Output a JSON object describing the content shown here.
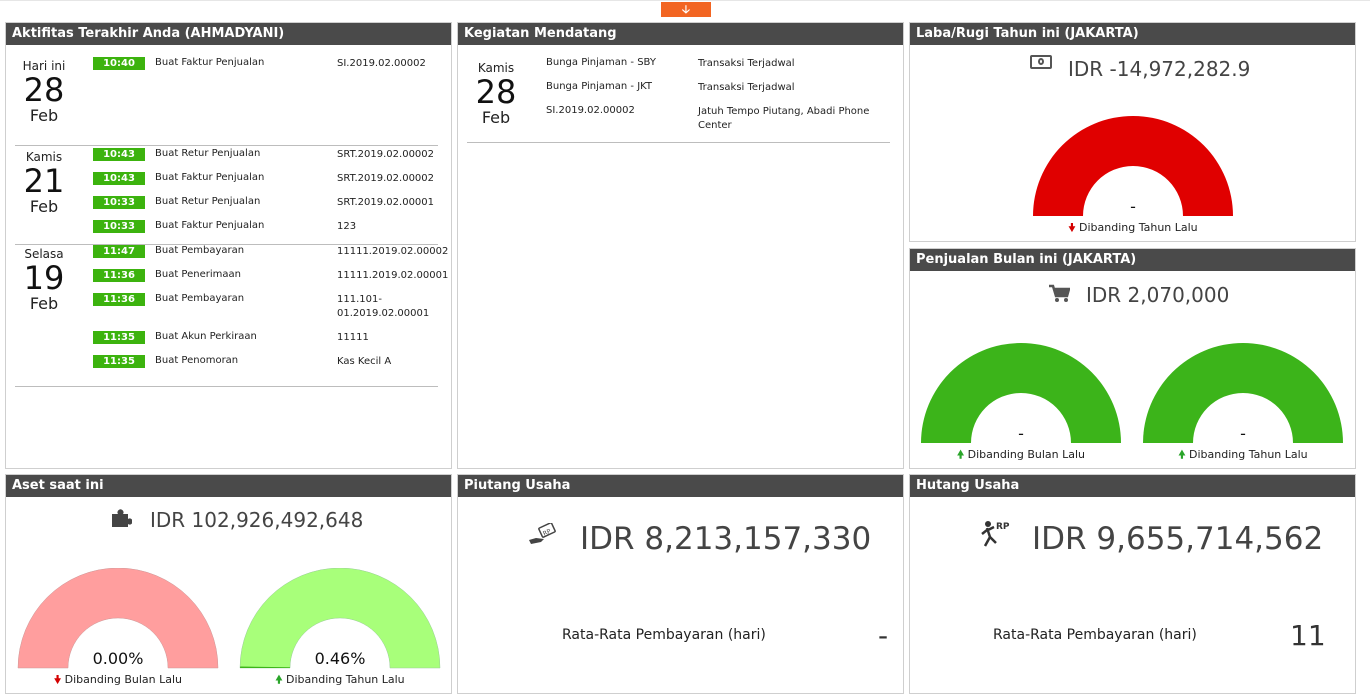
{
  "toggle_icon": "arrow-down-icon",
  "activities": {
    "title": "Aktifitas Terakhir Anda (AHMADYANI)",
    "groups": [
      {
        "day": "Hari ini",
        "date": "28",
        "month": "Feb",
        "items": [
          {
            "time": "10:40",
            "action": "Buat Faktur Penjualan",
            "ref": "SI.2019.02.00002"
          }
        ]
      },
      {
        "day": "Kamis",
        "date": "21",
        "month": "Feb",
        "items": [
          {
            "time": "10:43",
            "action": "Buat Retur Penjualan",
            "ref": "SRT.2019.02.00002"
          },
          {
            "time": "10:43",
            "action": "Buat Faktur Penjualan",
            "ref": "SRT.2019.02.00002"
          },
          {
            "time": "10:33",
            "action": "Buat Retur Penjualan",
            "ref": "SRT.2019.02.00001"
          },
          {
            "time": "10:33",
            "action": "Buat Faktur Penjualan",
            "ref": "123"
          }
        ]
      },
      {
        "day": "Selasa",
        "date": "19",
        "month": "Feb",
        "items": [
          {
            "time": "11:47",
            "action": "Buat Pembayaran",
            "ref": "11111.2019.02.00002"
          },
          {
            "time": "11:36",
            "action": "Buat Penerimaan",
            "ref": "11111.2019.02.00001"
          },
          {
            "time": "11:36",
            "action": "Buat Pembayaran",
            "ref": "111.101-01.2019.02.00001"
          },
          {
            "time": "11:35",
            "action": "Buat Akun Perkiraan",
            "ref": "11111"
          },
          {
            "time": "11:35",
            "action": "Buat Penomoran",
            "ref": "Kas Kecil A"
          }
        ]
      }
    ]
  },
  "upcoming": {
    "title": "Kegiatan Mendatang",
    "day": "Kamis",
    "date": "28",
    "month": "Feb",
    "items": [
      {
        "name": "Bunga Pinjaman - SBY",
        "desc": "Transaksi Terjadwal"
      },
      {
        "name": "Bunga Pinjaman - JKT",
        "desc": "Transaksi Terjadwal"
      },
      {
        "name": "SI.2019.02.00002",
        "desc": "Jatuh Tempo Piutang, Abadi Phone Center"
      }
    ]
  },
  "profit": {
    "title": "Laba/Rugi Tahun ini (JAKARTA)",
    "icon": "money-icon",
    "amount": "IDR -14,972,282.9",
    "gauge_value": "-",
    "caption": "Dibanding Tahun Lalu",
    "trend": "down",
    "color": "#e00000"
  },
  "sales": {
    "title": "Penjualan Bulan ini (JAKARTA)",
    "icon": "cart-icon",
    "amount": "IDR 2,070,000",
    "gauges": [
      {
        "value": "-",
        "caption": "Dibanding Bulan Lalu",
        "trend": "up",
        "color": "#3cb41a"
      },
      {
        "value": "-",
        "caption": "Dibanding Tahun Lalu",
        "trend": "up",
        "color": "#3cb41a"
      }
    ]
  },
  "assets": {
    "title": "Aset saat ini",
    "icon": "puzzle-icon",
    "amount": "IDR 102,926,492,648",
    "gauges": [
      {
        "value": "0.00%",
        "caption": "Dibanding Bulan Lalu",
        "trend": "down",
        "color": "#ff9e9e"
      },
      {
        "value": "0.46%",
        "caption": "Dibanding Tahun Lalu",
        "trend": "up",
        "color": "#a8ff7a"
      }
    ]
  },
  "receivables": {
    "title": "Piutang Usaha",
    "icon": "hand-money-icon",
    "amount": "IDR 8,213,157,330",
    "stat_label": "Rata-Rata Pembayaran (hari)",
    "stat_value": "-"
  },
  "payables": {
    "title": "Hutang Usaha",
    "icon": "running-rp-icon",
    "amount": "IDR 9,655,714,562",
    "stat_label": "Rata-Rata Pembayaran (hari)",
    "stat_value": "11"
  }
}
